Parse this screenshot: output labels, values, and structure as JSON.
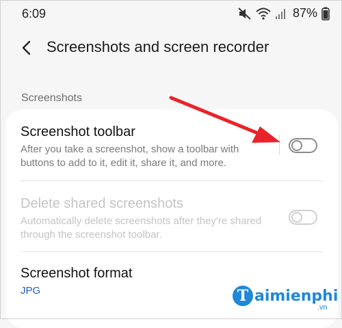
{
  "status_bar": {
    "time": "6:09",
    "icons": [
      "mute-icon",
      "wifi-icon",
      "signal-icon"
    ],
    "battery": "87%"
  },
  "header": {
    "back_icon": "chevron-left-icon",
    "title": "Screenshots and screen recorder"
  },
  "section": {
    "label": "Screenshots"
  },
  "settings": [
    {
      "title": "Screenshot toolbar",
      "description": "After you take a screenshot, show a toolbar with buttons to add to it, edit it, share it, and more.",
      "toggle_on": false,
      "enabled": true
    },
    {
      "title": "Delete shared screenshots",
      "description": "Automatically delete screenshots after they're shared through the screenshot toolbar.",
      "toggle_on": false,
      "enabled": false
    },
    {
      "title": "Screenshot format",
      "value": "JPG"
    }
  ],
  "annotation": {
    "color": "#e8242a"
  },
  "watermark": {
    "badge": "T",
    "text": "aimienphi",
    "sub": ".vn"
  }
}
